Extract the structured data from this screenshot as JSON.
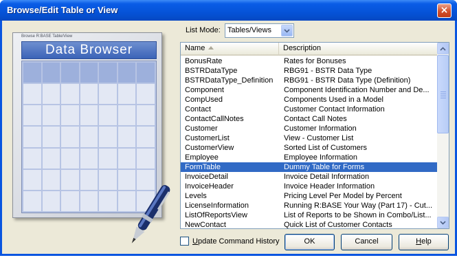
{
  "window": {
    "title": "Browse/Edit Table or View",
    "close_glyph": "×"
  },
  "illustration": {
    "caption": "Browse R:BASE Table/View",
    "banner": "Data Browser"
  },
  "list_mode": {
    "label": "List Mode:",
    "value": "Tables/Views"
  },
  "table": {
    "columns": [
      "Name",
      "Description"
    ],
    "selected_index": 11,
    "rows": [
      {
        "name": "BonusRate",
        "description": "Rates for Bonuses"
      },
      {
        "name": "BSTRDataType",
        "description": "RBG91 - BSTR Data Type"
      },
      {
        "name": "BSTRDataType_Definition",
        "description": "RBG91 - BSTR Data Type (Definition)"
      },
      {
        "name": "Component",
        "description": "Component Identification Number and De..."
      },
      {
        "name": "CompUsed",
        "description": "Components Used in a Model"
      },
      {
        "name": "Contact",
        "description": "Customer Contact Information"
      },
      {
        "name": "ContactCallNotes",
        "description": "Contact Call Notes"
      },
      {
        "name": "Customer",
        "description": "Customer Information"
      },
      {
        "name": "CustomerList",
        "description": "View - Customer List"
      },
      {
        "name": "CustomerView",
        "description": "Sorted List of Customers"
      },
      {
        "name": "Employee",
        "description": "Employee Information"
      },
      {
        "name": "FormTable",
        "description": "Dummy Table for Forms"
      },
      {
        "name": "InvoiceDetail",
        "description": "Invoice Detail Information"
      },
      {
        "name": "InvoiceHeader",
        "description": "Invoice Header Information"
      },
      {
        "name": "Levels",
        "description": "Pricing Level Per Model by Percent"
      },
      {
        "name": "LicenseInformation",
        "description": "Running R:BASE Your Way (Part 17) - Cut..."
      },
      {
        "name": "ListOfReportsView",
        "description": "List of Reports to be Shown in Combo/List..."
      },
      {
        "name": "NewContact",
        "description": "Quick List of Customer Contacts"
      }
    ]
  },
  "update_history": {
    "label": "Update Command History",
    "checked": false
  },
  "buttons": {
    "ok": "OK",
    "cancel": "Cancel",
    "help": "Help"
  },
  "colors": {
    "title_bar": "#0553d8",
    "selection": "#316ac5",
    "dialog_bg": "#ece9d8"
  }
}
